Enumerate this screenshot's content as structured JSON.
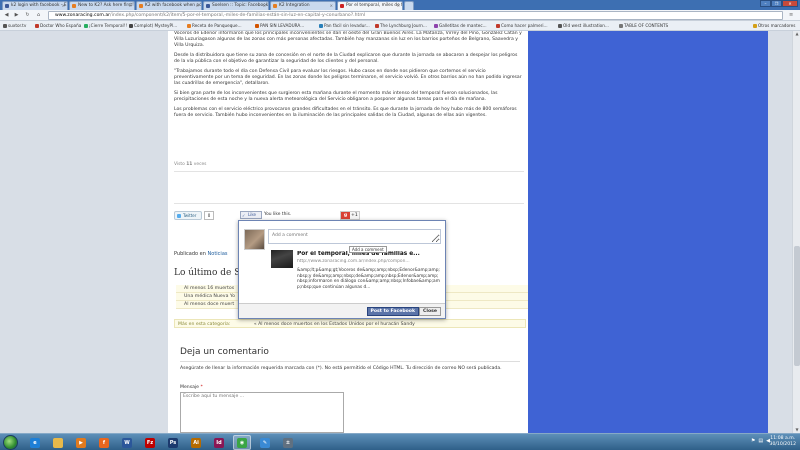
{
  "tabs": [
    {
      "label": "k2 login with facebook - E",
      "color": "#3b5998",
      "active": false
    },
    {
      "label": "New to K2? Ask here first!",
      "color": "#e67e22",
      "active": false
    },
    {
      "label": "K2 with facebook when acc",
      "color": "#e67e22",
      "active": false
    },
    {
      "label": "Soelsen :: Topic: Facebook",
      "color": "#3b5998",
      "active": false
    },
    {
      "label": "K2 Integration",
      "color": "#e67e22",
      "active": false
    },
    {
      "label": "Por el temporal, miles de f",
      "color": "#cc2222",
      "active": true
    }
  ],
  "address": {
    "domain": "www.zonaracing.com.ar",
    "path": "/index.php/component/k2/item/5-por-el-temporal,-miles-de-familias-están-sin-luz-en-capital-y-conurbano?.html"
  },
  "bookmarks": [
    {
      "label": "suxtor.tv",
      "color": "#555"
    },
    {
      "label": "Doctor Who España",
      "color": "#c0392b"
    },
    {
      "label": "¡Cierre Temporal!!",
      "color": "#27ae60"
    },
    {
      "label": "Complot) MysteyPl...",
      "color": "#444"
    },
    {
      "label": "Receta de Panqueque...",
      "color": "#e67e22"
    },
    {
      "label": "PAN SIN LEVADURA...",
      "color": "#d35400"
    },
    {
      "label": "Pan fácil sin levadur...",
      "color": "#2980b9"
    },
    {
      "label": "The Lynchburg Journ...",
      "color": "#c0392b"
    },
    {
      "label": "Galletitas de mantec...",
      "color": "#8e44ad"
    },
    {
      "label": "Como hacer palmeri...",
      "color": "#c0392b"
    },
    {
      "label": "Old west illustration...",
      "color": "#555"
    },
    {
      "label": "TABLE OF CONTENTS",
      "color": "#777"
    },
    {
      "label": "Otros marcadores",
      "color": "#d4a017"
    }
  ],
  "article": {
    "paragraphs": [
      "Voceros de Edenor informaron que los principales inconvenientes se dan el oeste del Gran Buenos Aires. La Matanza, Virrey del Pino, González Catán y Villa Luzuriagason algunas de las zonas con más personas afectadas. También hay manzanas sin luz en los barrios porteños de Belgrano, Saavedra y Villa Urquiza.",
      "Desde la distribuidora que tiene su zona de concesión en el norte de la Ciudad explicaron que durante la jornada se abocaron a despejar los peligros de la vía pública con el objetivo de garantizar la seguridad de los clientes y del personal.",
      "\"Trabajamos durante todo el día con Defensa Civil para evaluar los riesgos. Hubo casos en donde nos pidieron que cortemos el servicio preventivamente por un tema de seguridad. En las zonas donde los peligros terminaron, el servicio volvió. En otros barrios aún no han podido ingresar las cuadrillas de emergencia\", detallaron.",
      "Si bien gran parte de los inconvenientes que surgieron esta mañana durante el momento más intenso del temporal fueron solucionados, las precipitaciones de esta noche y la nueva alerta meteorológica del Servicio obligaron a posponer algunas tareas para el día de mañana.",
      "Los problemas con el servicio eléctrico provocaron grandes dificultades en el tránsito. Es que durante la jornada de hoy hubo más de 800 semáforos fuera de servicio. También hubo inconvenientes en la iluminación de las principales salidas de la Ciudad, algunas de ellas aún vigentes."
    ],
    "votes_prefix": "Visto",
    "votes_count": "11",
    "votes_suffix": "veces"
  },
  "social": {
    "twitter_label": "Twitter",
    "twitter_count": "0",
    "like_label": "Like",
    "you_like": "You like this.",
    "gplus_label": "+1"
  },
  "published": {
    "prefix": "Publicado en",
    "category": "Noticias"
  },
  "latest": {
    "title": "Lo último de Sup",
    "items": [
      "Al menos 16 muertos",
      "Una médica Nueva Yo",
      "Al menos doce muert"
    ],
    "more_label": "Más en esta categoría:",
    "more_link": "« Al menos doce muertos en los Estados Unidos por el huracán Sandy"
  },
  "comment": {
    "title": "Deja un comentario",
    "desc": "Asegúrate de llenar la información requerida marcada con (*). No está permitido el Código HTML. Tu dirección de correo NO será publicada.",
    "msg_label": "Mensaje",
    "msg_required": "*",
    "msg_placeholder": "Escribe aquí tu mensaje ..."
  },
  "fb_popup": {
    "comment_placeholder": "Add a comment",
    "tooltip": "Add a comment",
    "link_title": "Por el temporal, miles de familias e...",
    "link_url": "http://www.zonaracing.com.ar/index.php/compon...",
    "desc": "&amp;lt;p&amp;gt;Voceros de&amp;amp;nbsp;Edenor&amp;amp;nbsp;y de&amp;amp;nbsp;de&amp;amp;nbsp;Edenor&amp;amp;nbsp;informaron en diálogo con&amp;amp;nbsp;Infobae&amp;amp;nbsp;que continúan algunas d...",
    "post_label": "Post to Facebook",
    "close_label": "Close"
  },
  "taskbar": {
    "apps": [
      {
        "name": "ie",
        "color": "#1e7fd6",
        "glyph": "e"
      },
      {
        "name": "folder",
        "color": "#e8b94a",
        "glyph": ""
      },
      {
        "name": "media",
        "color": "#e07a1f",
        "glyph": "▶"
      },
      {
        "name": "firefox",
        "color": "#e8661f",
        "glyph": "f"
      },
      {
        "name": "word",
        "color": "#2b579a",
        "glyph": "W"
      },
      {
        "name": "filezilla",
        "color": "#bf0000",
        "glyph": "Fz"
      },
      {
        "name": "photoshop",
        "color": "#1c3a6e",
        "glyph": "Ps"
      },
      {
        "name": "illustrator",
        "color": "#b56a00",
        "glyph": "Ai"
      },
      {
        "name": "indesign",
        "color": "#8a1654",
        "glyph": "Id"
      },
      {
        "name": "chrome",
        "color": "#3aa545",
        "glyph": "◉"
      },
      {
        "name": "paint",
        "color": "#3a8ad4",
        "glyph": "✎"
      },
      {
        "name": "calc",
        "color": "#607080",
        "glyph": "±"
      }
    ],
    "clock_time": "11:08 a.m.",
    "clock_date": "30/10/2012"
  }
}
